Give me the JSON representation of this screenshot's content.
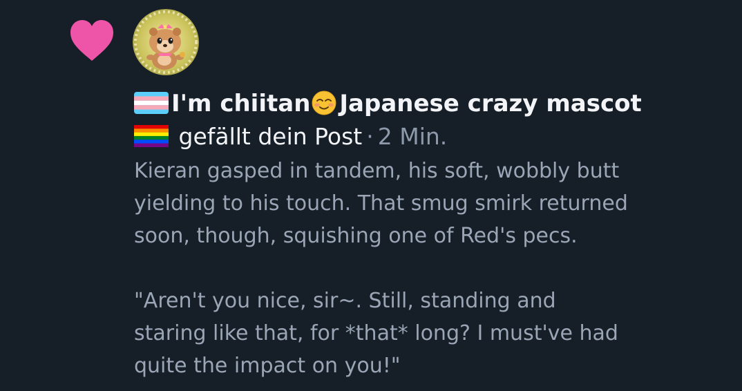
{
  "notification": {
    "icon": "heart-icon",
    "icon_color": "#ee55a8",
    "avatar": "mascot-avatar",
    "user_display_name_part1": "I'm chiitan",
    "user_display_name_part2": "Japanese crazy mascot",
    "action_text": "gefällt dein Post",
    "separator": "·",
    "time_ago": "2 Min.",
    "post_text": {
      "line1": "Kieran gasped in tandem, his soft, wobbly butt",
      "line2": "yielding to his touch. That smug smirk returned",
      "line3": "soon, though, squishing one of Red's pecs.",
      "line4": "\"Aren't you nice, sir~. Still, standing and",
      "line5": "staring like that, for *that* long? I must've had",
      "line6": "quite the impact on you!\""
    }
  },
  "colors": {
    "background": "#161e27",
    "primary_text": "#f2f4f7",
    "secondary_text": "#8d9aab"
  }
}
